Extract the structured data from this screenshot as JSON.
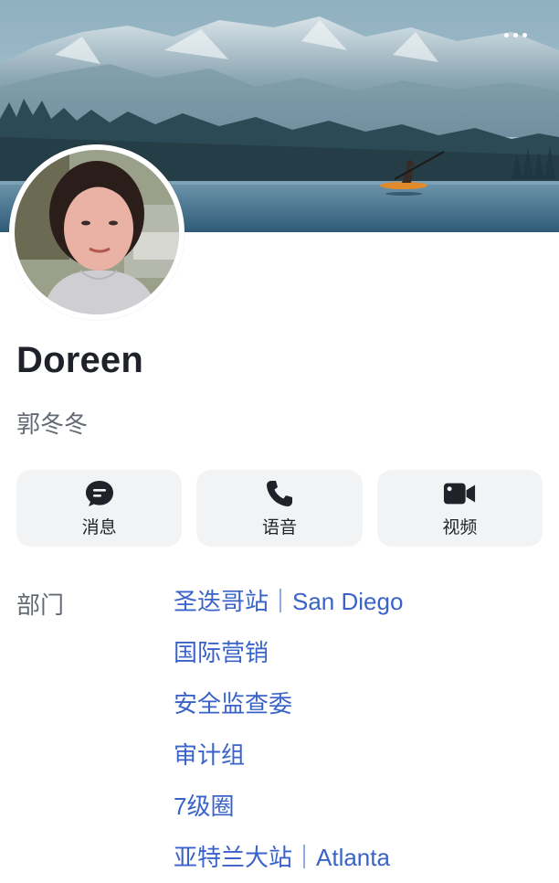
{
  "header": {
    "more_icon": "more-horizontal-icon"
  },
  "profile": {
    "name": "Doreen",
    "alias": "郭冬冬"
  },
  "actions": [
    {
      "label": "消息",
      "icon": "chat-bubble-icon"
    },
    {
      "label": "语音",
      "icon": "phone-icon"
    },
    {
      "label": "视频",
      "icon": "video-camera-icon"
    }
  ],
  "department": {
    "label": "部门",
    "items": [
      "圣迭哥站｜San Diego",
      "国际营销",
      "安全监查委",
      "审计组",
      "7级圈",
      "亚特兰大站｜Atlanta"
    ]
  },
  "colors": {
    "link": "#3a63c9",
    "secondary_text": "#646a73",
    "button_bg": "#f2f3f5",
    "icon": "#1f2329"
  }
}
